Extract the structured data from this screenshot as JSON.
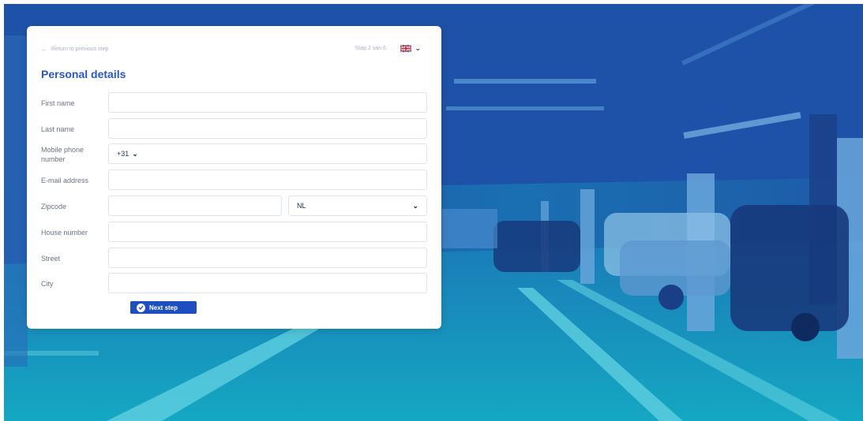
{
  "form": {
    "back_label": "Return to previous step",
    "step_indicator": "Stap 2 van 6",
    "language_icon": "uk-flag-icon",
    "title": "Personal details",
    "fields": {
      "first_name": {
        "label": "First name",
        "value": ""
      },
      "last_name": {
        "label": "Last name",
        "value": ""
      },
      "mobile": {
        "label": "Mobile phone number",
        "country_code": "+31",
        "value": ""
      },
      "email": {
        "label": "E-mail address",
        "value": ""
      },
      "zipcode": {
        "label": "Zipcode",
        "value": "",
        "country": "NL"
      },
      "house_number": {
        "label": "House number",
        "value": ""
      },
      "street": {
        "label": "Street",
        "value": ""
      },
      "city": {
        "label": "City",
        "value": ""
      }
    },
    "next_label": "Next step"
  },
  "colors": {
    "accent": "#2b56c7",
    "button": "#1f4ec0",
    "background_overlay": "#1d5fae"
  }
}
